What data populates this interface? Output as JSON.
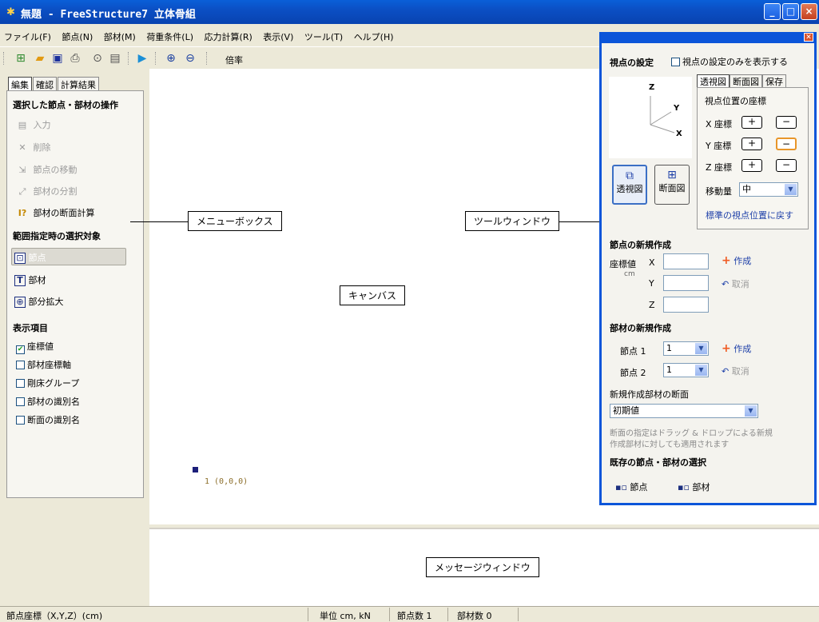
{
  "window": {
    "title": "無題 - FreeStructure7 立体骨組",
    "min": "_",
    "max": "□",
    "close": "×"
  },
  "menu": [
    "ファイル(F)",
    "節点(N)",
    "部材(M)",
    "荷重条件(L)",
    "応力計算(R)",
    "表示(V)",
    "ツール(T)",
    "ヘルプ(H)"
  ],
  "toolbar": {
    "zoom_label": "倍率"
  },
  "left": {
    "tabs": [
      "編集",
      "確認",
      "計算結果"
    ],
    "section1": "選択した節点・部材の操作",
    "ops": [
      {
        "icon": "▤",
        "label": "入力"
      },
      {
        "icon": "✕",
        "label": "削除"
      },
      {
        "icon": "⇲",
        "label": "節点の移動"
      },
      {
        "icon": "⤢",
        "label": "部材の分割"
      },
      {
        "icon": "I?",
        "label": "部材の断面計算"
      }
    ],
    "section2": "範囲指定時の選択対象",
    "targets": [
      {
        "icon": "⊡",
        "label": "節点"
      },
      {
        "icon": "T",
        "label": "部材"
      },
      {
        "icon": "⊕",
        "label": "部分拡大"
      }
    ],
    "section3": "表示項目",
    "display": [
      {
        "label": "座標値",
        "checked": true
      },
      {
        "label": "部材座標軸",
        "checked": false
      },
      {
        "label": "剛床グループ",
        "checked": false
      },
      {
        "label": "部材の識別名",
        "checked": false
      },
      {
        "label": "断面の識別名",
        "checked": false
      }
    ]
  },
  "canvas": {
    "node_label": "1  (0,0,0)",
    "callout_menu": "メニューボックス",
    "callout_tool": "ツールウィンドウ",
    "callout_canvas": "キャンバス",
    "callout_msg": "メッセージウィンドウ"
  },
  "tool": {
    "viewpoint_title": "視点の設定",
    "viewpoint_only": "視点の設定のみを表示する",
    "axes": {
      "z": "Z",
      "y": "Y",
      "x": "X"
    },
    "tabs": [
      "透視図",
      "断面図",
      "保存"
    ],
    "coord_title": "視点位置の座標",
    "coords": [
      "X 座標",
      "Y 座標",
      "Z 座標"
    ],
    "plus": "+",
    "minus": "−",
    "move_label": "移動量",
    "move_value": "中",
    "view_buttons": [
      "透視図",
      "断面図"
    ],
    "reset_link": "標準の視点位置に戻す",
    "node_new_title": "節点の新規作成",
    "coord_label": "座標値",
    "unit": "cm",
    "xyz": [
      "X",
      "Y",
      "Z"
    ],
    "create": "作成",
    "cancel": "取消",
    "member_new_title": "部材の新規作成",
    "node1": "節点 1",
    "node2": "節点 2",
    "node1_value": "1",
    "node2_value": "1",
    "section_label": "新規作成部材の断面",
    "section_value": "初期値",
    "note1": "断面の指定はドラッグ & ドロップによる新規",
    "note2": "作成部材に対しても適用されます",
    "existing_title": "既存の節点・部材の選択",
    "existing_node": "節点",
    "existing_member": "部材"
  },
  "status": {
    "coords": "節点座標（X,Y,Z）(cm)",
    "unit": "単位 cm, kN",
    "nodes": "節点数 1",
    "members": "部材数 0"
  }
}
